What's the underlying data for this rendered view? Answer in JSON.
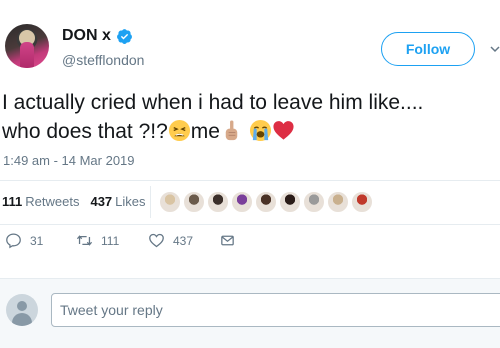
{
  "user": {
    "name": "DON x",
    "handle": "@stefflondon",
    "follow_label": "Follow"
  },
  "tweet": {
    "text_part1": "I actually cried when i had to leave him like....",
    "text_part2": "who does that ?!?",
    "text_part3": "me",
    "emojis": [
      "weary-face-emoji",
      "index-pointing-up-emoji",
      "loudly-crying-face-emoji",
      "red-heart-emoji"
    ],
    "timestamp": "1:49 am - 14 Mar 2019"
  },
  "stats": {
    "retweets_count": "111",
    "retweets_label": "Retweets",
    "likes_count": "437",
    "likes_label": "Likes"
  },
  "likers": [
    {
      "name": "liker-1",
      "color": "#d9c4a3"
    },
    {
      "name": "liker-2",
      "color": "#6b5b4b"
    },
    {
      "name": "liker-3",
      "color": "#3b2f2a"
    },
    {
      "name": "liker-4",
      "color": "#7a3f9a"
    },
    {
      "name": "liker-5",
      "color": "#4a3226"
    },
    {
      "name": "liker-6",
      "color": "#2a1c18"
    },
    {
      "name": "liker-7",
      "color": "#9a9a9a"
    },
    {
      "name": "liker-8",
      "color": "#c9b08e"
    },
    {
      "name": "liker-9",
      "color": "#c0392b"
    }
  ],
  "actions": {
    "replies": "31",
    "retweets": "111",
    "likes": "437"
  },
  "reply": {
    "placeholder": "Tweet your reply"
  },
  "colors": {
    "accent": "#1da1f2",
    "muted": "#657786"
  }
}
